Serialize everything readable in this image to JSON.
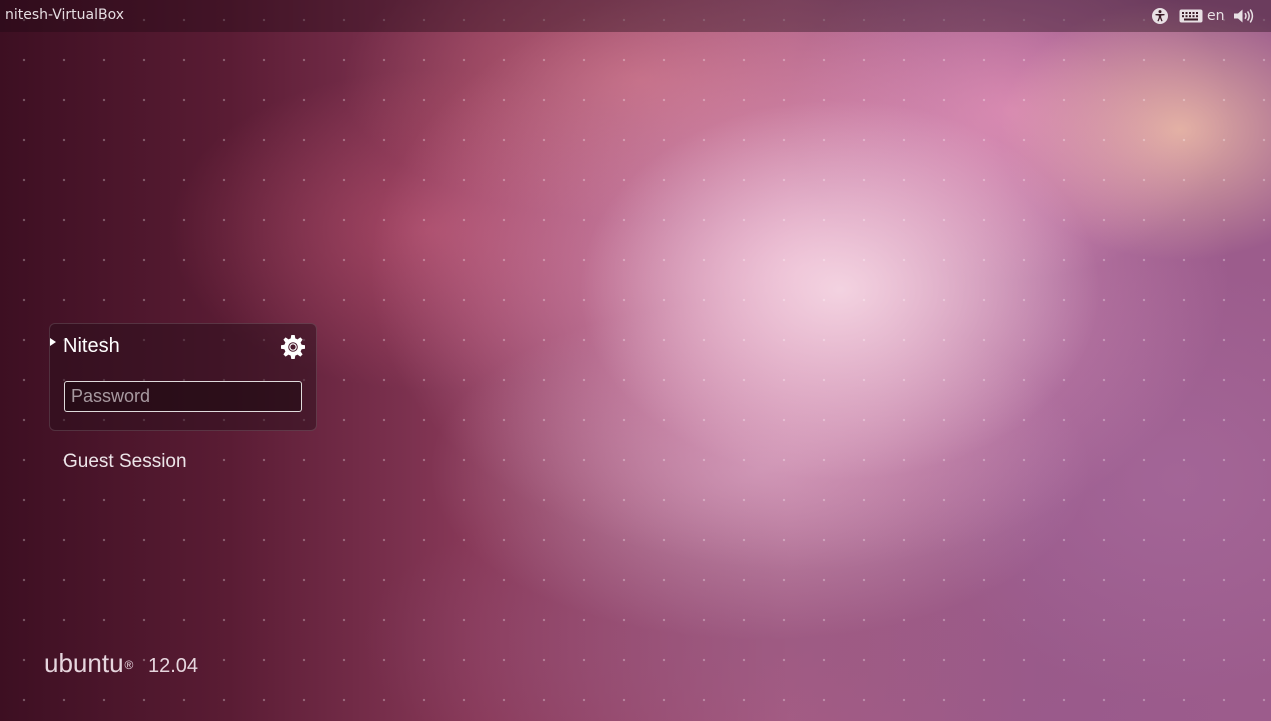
{
  "top_panel": {
    "hostname": "nitesh-VirtualBox",
    "icons": [
      "accessibility-icon",
      "keyboard-icon",
      "volume-icon"
    ],
    "keyboard_layout": "en"
  },
  "login": {
    "user_name": "Nitesh",
    "password_placeholder": "Password",
    "password_value": "",
    "session_icon": "gear-icon",
    "guest_session_label": "Guest Session"
  },
  "branding": {
    "logo_text": "ubuntu",
    "registered_mark": "®",
    "version": "12.04"
  },
  "colors": {
    "panel_background": "#1e0812",
    "text": "#ffffff",
    "wallpaper_dark": "#3d0f22",
    "wallpaper_light": "#f4d6e2"
  }
}
